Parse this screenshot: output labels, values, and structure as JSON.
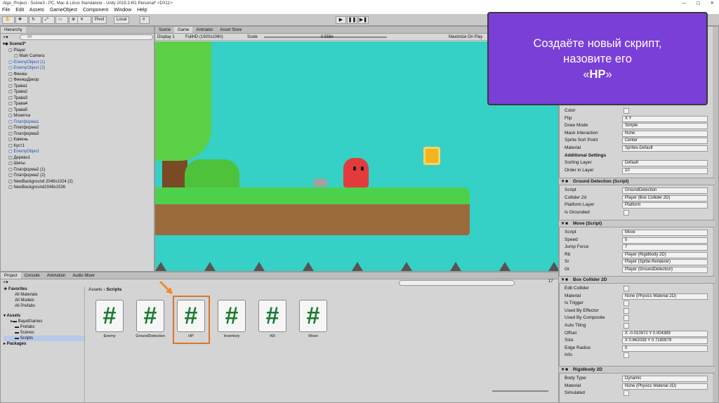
{
  "window": {
    "title": "Algo_Project - Scene3 - PC, Mac & Linux Standalone - Unity 2019.3.6f1 Personal* <DX11>",
    "controls": [
      "—",
      "▢",
      "✕"
    ]
  },
  "menu": [
    "File",
    "Edit",
    "Assets",
    "GameObject",
    "Component",
    "Window",
    "Help"
  ],
  "toolbar": {
    "pivot": "Pivot",
    "local": "Local",
    "play": "▶",
    "pause": "❚❚",
    "step": "▶❚"
  },
  "hierarchy": {
    "tab": "Hierarchy",
    "search_placeholder": "All",
    "items": [
      {
        "label": "Scene3*",
        "indent": 0,
        "color": "black",
        "bold": true
      },
      {
        "label": "Player",
        "indent": 1,
        "color": "black"
      },
      {
        "label": "Main Camera",
        "indent": 2,
        "color": "black"
      },
      {
        "label": "EnemyObject (1)",
        "indent": 1,
        "color": "blue"
      },
      {
        "label": "EnemyObject (2)",
        "indent": 1,
        "color": "blue"
      },
      {
        "label": "Финиш",
        "indent": 1,
        "color": "black"
      },
      {
        "label": "ФинишДекор",
        "indent": 1,
        "color": "black"
      },
      {
        "label": "Трава1",
        "indent": 1,
        "color": "black"
      },
      {
        "label": "Трава2",
        "indent": 1,
        "color": "black"
      },
      {
        "label": "Трава3",
        "indent": 1,
        "color": "black"
      },
      {
        "label": "Трава4",
        "indent": 1,
        "color": "black"
      },
      {
        "label": "Трава5",
        "indent": 1,
        "color": "black"
      },
      {
        "label": "Монетка",
        "indent": 1,
        "color": "black"
      },
      {
        "label": "Платформа1",
        "indent": 1,
        "color": "blue"
      },
      {
        "label": "Платформа2",
        "indent": 1,
        "color": "black"
      },
      {
        "label": "Платформа3",
        "indent": 1,
        "color": "black"
      },
      {
        "label": "Камень",
        "indent": 1,
        "color": "black"
      },
      {
        "label": "Куст1",
        "indent": 1,
        "color": "black"
      },
      {
        "label": "EnemyObject",
        "indent": 1,
        "color": "blue"
      },
      {
        "label": "Дерево1",
        "indent": 1,
        "color": "black"
      },
      {
        "label": "Шипы",
        "indent": 1,
        "color": "black"
      },
      {
        "label": "Платформа2 (1)",
        "indent": 1,
        "color": "black"
      },
      {
        "label": "Платформа2 (2)",
        "indent": 1,
        "color": "black"
      },
      {
        "label": "NewBackground 2048x1024 (2)",
        "indent": 1,
        "color": "black"
      },
      {
        "label": "NewBackground2048x1536",
        "indent": 1,
        "color": "black"
      }
    ]
  },
  "scene_tabs": [
    "Scene",
    "Game",
    "Animator",
    "Asset Store"
  ],
  "game_bar": {
    "display": "Display 1",
    "resolution": "FullHD (1920x1080)",
    "scale_label": "Scale",
    "scale_value": "0.558x",
    "maximize": "Maximize On Play"
  },
  "bottom_tabs": [
    "Project",
    "Console",
    "Animation",
    "Audio Mixer"
  ],
  "project": {
    "favorites_label": "Favorites",
    "favorites": [
      "All Materials",
      "All Models",
      "All Prefabs"
    ],
    "assets_label": "Assets",
    "assets": [
      "BayatGames",
      "Prefabs",
      "Scenes",
      "Scripts"
    ],
    "packages_label": "Packages",
    "breadcrumb_root": "Assets",
    "breadcrumb_sep": "›",
    "breadcrumb_current": "Scripts",
    "count_badge": "17",
    "scripts": [
      {
        "name": "Enemy",
        "glyph": "#"
      },
      {
        "name": "GroundDetection",
        "glyph": "#"
      },
      {
        "name": "HP",
        "glyph": "#"
      },
      {
        "name": "Inventory",
        "glyph": "#"
      },
      {
        "name": "Kill",
        "glyph": "#"
      },
      {
        "name": "Move",
        "glyph": "#"
      }
    ]
  },
  "callout": {
    "line1": "Создаёте новый скрипт,",
    "line2": "назовите его",
    "quote_open": "«",
    "name": "HP",
    "quote_close": "»",
    "color": "#7a3fd6"
  },
  "inspector": {
    "sprite_rows": [
      {
        "label": "Color",
        "value": ""
      },
      {
        "label": "Flip",
        "value": "X   Y"
      },
      {
        "label": "Draw Mode",
        "value": "Simple"
      },
      {
        "label": "Mask Interaction",
        "value": "None"
      },
      {
        "label": "Sprite Sort Point",
        "value": "Center"
      },
      {
        "label": "Material",
        "value": "Sprites-Default"
      }
    ],
    "additional_settings": "Additional Settings",
    "additional_rows": [
      {
        "label": "Sorting Layer",
        "value": "Default"
      },
      {
        "label": "Order in Layer",
        "value": "10"
      }
    ],
    "ground_title": "Ground Detection (Script)",
    "ground_rows": [
      {
        "label": "Script",
        "value": "GroundDetection"
      },
      {
        "label": "Collider 2d",
        "value": "Player (Box Collider 2D)"
      },
      {
        "label": "Platform Layer",
        "value": "Platform"
      },
      {
        "label": "Is Grounded",
        "value": ""
      }
    ],
    "move_title": "Move (Script)",
    "move_rows": [
      {
        "label": "Script",
        "value": "Move"
      },
      {
        "label": "Speed",
        "value": "5"
      },
      {
        "label": "Jump Force",
        "value": "7"
      },
      {
        "label": "Rb",
        "value": "Player (Rigidbody 2D)"
      },
      {
        "label": "Sr",
        "value": "Player (Sprite Renderer)"
      },
      {
        "label": "Gr",
        "value": "Player (GroundDetection)"
      }
    ],
    "box_title": "Box Collider 2D",
    "box_rows": [
      {
        "label": "Edit Collider",
        "value": ""
      },
      {
        "label": "Material",
        "value": "None (Physics Material 2D)"
      },
      {
        "label": "Is Trigger",
        "value": ""
      },
      {
        "label": "Used By Effector",
        "value": ""
      },
      {
        "label": "Used By Composite",
        "value": ""
      },
      {
        "label": "Auto Tiling",
        "value": ""
      },
      {
        "label": "Offset",
        "value": "X -0.010972   Y 0.004389"
      },
      {
        "label": "Size",
        "value": "X 0.662039   Y 0.7180979"
      },
      {
        "label": "Edge Radius",
        "value": "0"
      },
      {
        "label": "Info",
        "value": ""
      }
    ],
    "rigid_title": "Rigidbody 2D",
    "rigid_rows": [
      {
        "label": "Body Type",
        "value": "Dynamic"
      },
      {
        "label": "Material",
        "value": "None (Physics Material 2D)"
      },
      {
        "label": "Simulated",
        "value": ""
      }
    ]
  }
}
